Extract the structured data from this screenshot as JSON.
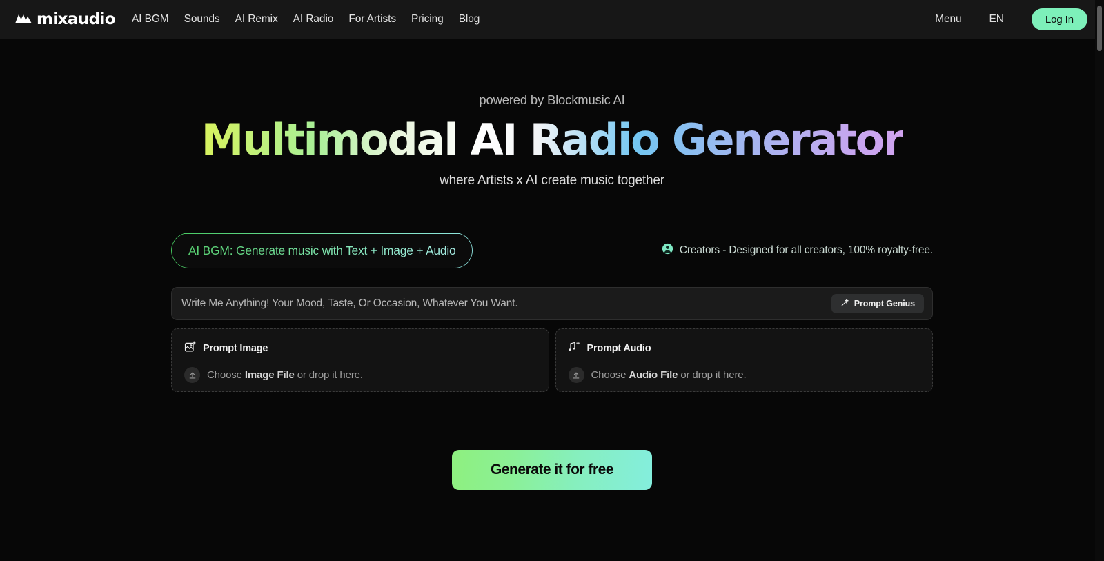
{
  "nav": {
    "logo_text": "mixaudio",
    "logo_icon": "mixaudio-mountain-icon",
    "links": [
      {
        "label": "AI BGM"
      },
      {
        "label": "Sounds"
      },
      {
        "label": "AI Remix"
      },
      {
        "label": "AI Radio"
      },
      {
        "label": "For Artists"
      },
      {
        "label": "Pricing"
      },
      {
        "label": "Blog"
      }
    ],
    "menu_label": "Menu",
    "language_label": "EN",
    "login_label": "Log In",
    "login_bg": "#7df0ba"
  },
  "hero": {
    "eyebrow": "powered by Blockmusic AI",
    "title": "Multimodal AI Radio Generator",
    "subtitle": "where Artists x AI create music together",
    "gradient_start": "#d8f25e",
    "gradient_mid": "#ffffff",
    "gradient_end": "#d0a3ef"
  },
  "generator": {
    "mode_pill_label": "AI BGM: Generate music with Text + Image + Audio",
    "mode_pill_gradient_start": "#46c85f",
    "mode_pill_gradient_end": "#8fe4e0",
    "creators_note": "Creators - Designed for all creators, 100% royalty-free.",
    "creators_icon": "person-circle-icon",
    "prompt": {
      "value": "",
      "placeholder": "Write Me Anything! Your Mood, Taste, Or Occasion, Whatever You Want."
    },
    "genius_button": {
      "label": "Prompt Genius",
      "icon": "magic-wand-icon"
    },
    "cards": [
      {
        "title": "Prompt Image",
        "title_icon": "image-plus-icon",
        "upload_icon": "upload-arrow-icon",
        "hint_prefix": "Choose ",
        "hint_strong": "Image File",
        "hint_suffix": " or drop it here."
      },
      {
        "title": "Prompt Audio",
        "title_icon": "music-note-plus-icon",
        "upload_icon": "upload-arrow-icon",
        "hint_prefix": "Choose ",
        "hint_strong": "Audio File",
        "hint_suffix": " or drop it here."
      }
    ],
    "cta_label": "Generate it for free",
    "cta_gradient_start": "#8ef07f",
    "cta_gradient_end": "#84eedd"
  }
}
